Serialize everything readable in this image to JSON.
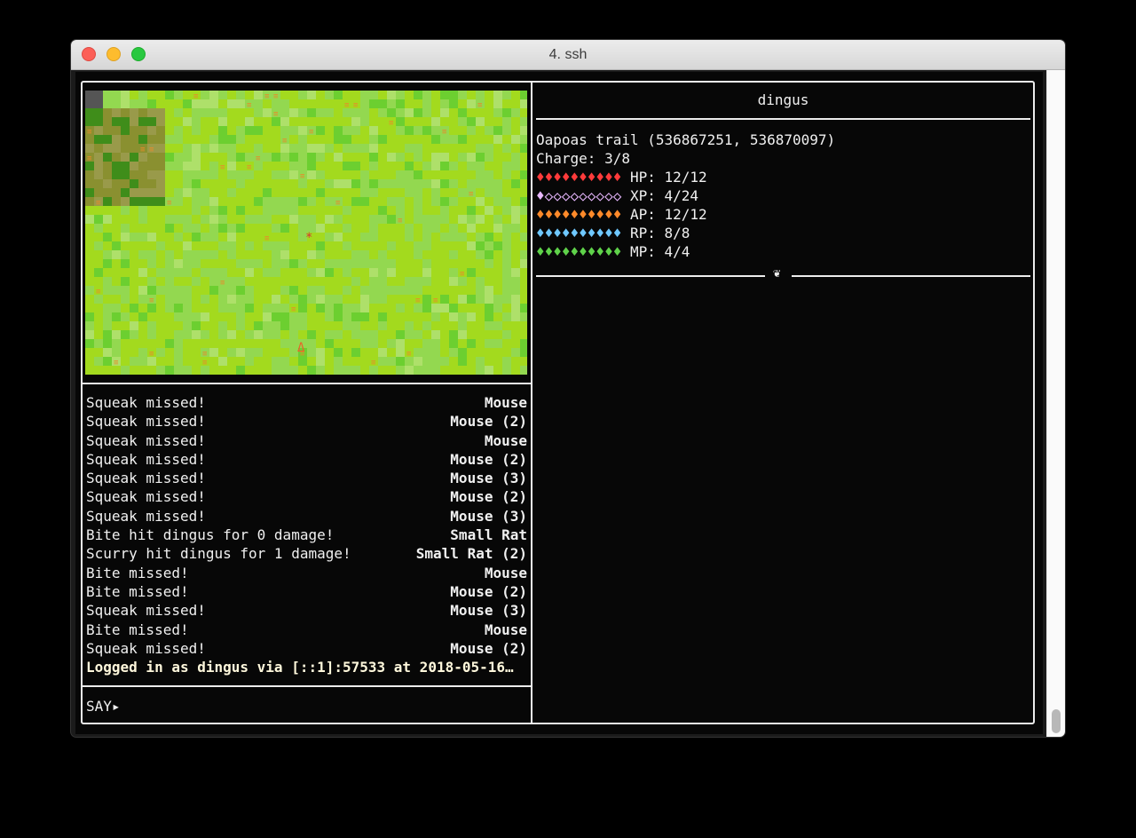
{
  "window": {
    "title": "4. ssh"
  },
  "colors": {
    "hp": "#ff3b3b",
    "xp": "#e8b8ff",
    "ap": "#ff8a2a",
    "rp": "#6fc8ff",
    "mp": "#5fd24a",
    "grass": "#a3da1e"
  },
  "map": {
    "player_glyph": "*",
    "marker_glyph": "Δ"
  },
  "log": [
    {
      "msg": "Squeak missed!",
      "source": "Mouse"
    },
    {
      "msg": "Squeak missed!",
      "source": "Mouse (2)"
    },
    {
      "msg": "Squeak missed!",
      "source": "Mouse"
    },
    {
      "msg": "Squeak missed!",
      "source": "Mouse (2)"
    },
    {
      "msg": "Squeak missed!",
      "source": "Mouse (3)"
    },
    {
      "msg": "Squeak missed!",
      "source": "Mouse (2)"
    },
    {
      "msg": "Squeak missed!",
      "source": "Mouse (3)"
    },
    {
      "msg": "Bite hit dingus for 0 damage!",
      "source": "Small Rat"
    },
    {
      "msg": "Scurry hit dingus for 1 damage!",
      "source": "Small Rat (2)"
    },
    {
      "msg": "Bite missed!",
      "source": "Mouse"
    },
    {
      "msg": "Bite missed!",
      "source": "Mouse (2)"
    },
    {
      "msg": "Squeak missed!",
      "source": "Mouse (3)"
    },
    {
      "msg": "Bite missed!",
      "source": "Mouse"
    },
    {
      "msg": "Squeak missed!",
      "source": "Mouse (2)"
    }
  ],
  "login_message": "Logged in as dingus via [::1]:57533 at 2018-05-16…",
  "prompt": "SAY▸",
  "character": {
    "name": "dingus",
    "location": "Oapoas trail (536867251, 536870097)",
    "charge": "Charge: 3/8",
    "stats": {
      "hp": {
        "bar": "♦♦♦♦♦♦♦♦♦♦",
        "label": "HP: 12/12",
        "current": 12,
        "max": 12
      },
      "xp": {
        "bar": "♦◇◇◇◇◇◇◇◇◇",
        "label": "XP: 4/24",
        "current": 4,
        "max": 24
      },
      "ap": {
        "bar": "♦♦♦♦♦♦♦♦♦♦",
        "label": "AP: 12/12",
        "current": 12,
        "max": 12
      },
      "rp": {
        "bar": "♦♦♦♦♦♦♦♦♦♦",
        "label": "RP: 8/8",
        "current": 8,
        "max": 8
      },
      "mp": {
        "bar": "♦♦♦♦♦♦♦♦♦♦",
        "label": "MP: 4/4",
        "current": 4,
        "max": 4
      }
    },
    "separator_icon": "❦"
  }
}
